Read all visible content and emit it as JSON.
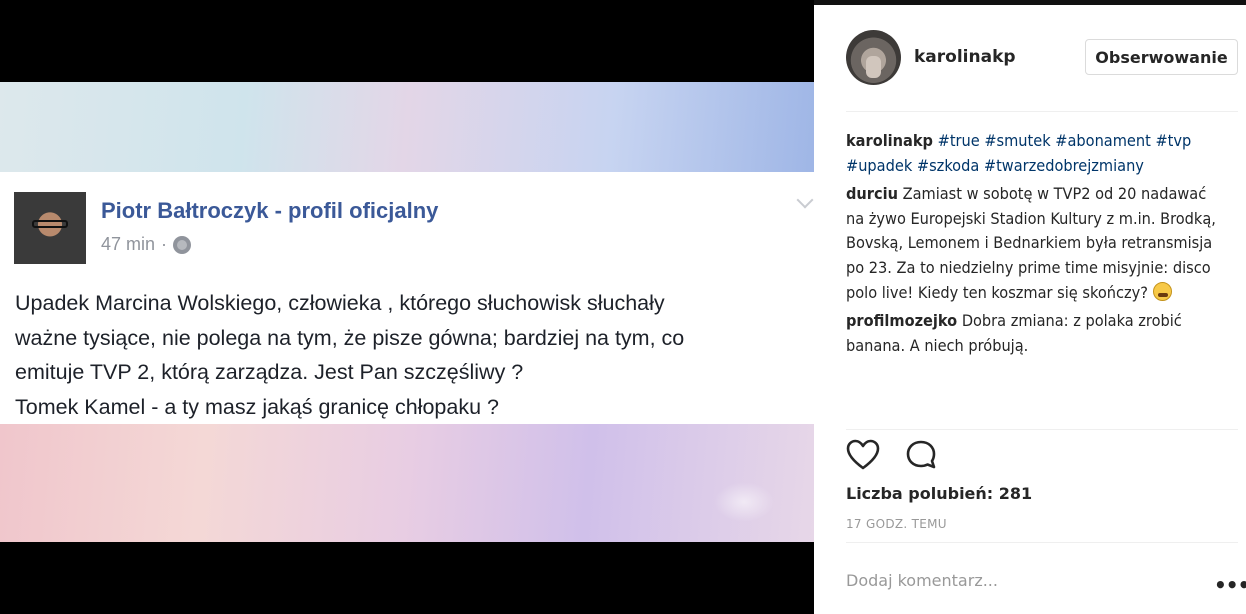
{
  "post": {
    "fb_card": {
      "author": "Piotr Bałtroczyk - profil oficjalny",
      "time": "47 min",
      "separator": "·",
      "privacy_icon": "globe-icon",
      "lines": [
        "Upadek Marcina Wolskiego, człowieka , którego słuchowisk słuchały",
        "ważne tysiące, nie polega na tym, że pisze gówna; bardziej na tym, co",
        "emituje TVP 2, którą zarządza. Jest Pan szczęśliwy ?",
        "Tomek Kamel - a ty masz jakąś granicę chłopaku ?"
      ]
    }
  },
  "sidebar": {
    "username": "karolinakp",
    "follow_label": "Obserwowanie",
    "caption": {
      "user": "karolinakp",
      "tags": [
        "#true",
        "#smutek",
        "#abonament",
        "#tvp",
        "#upadek",
        "#szkoda",
        "#twarzedobrejzmiany"
      ]
    },
    "comments": [
      {
        "user": "durciu",
        "text": "Zamiast w sobotę w TVP2 od 20 nadawać na żywo Europejski Stadion Kultury z m.in. Brodką, Bovską, Lemonem i Bednarkiem była retransmisja po 23. Za to niedzielny prime time misyjnie: disco polo live! Kiedy ten koszmar się skończy?",
        "emoji": "tired-face-emoji"
      },
      {
        "user": "profilmozejko",
        "text": "Dobra zmiana: z polaka zrobić banana. A niech próbują."
      }
    ],
    "likes": "Liczba polubień: 281",
    "time_ago": "17 GODZ. TEMU",
    "comment_placeholder": "Dodaj komentarz...",
    "more_label": "•••"
  }
}
